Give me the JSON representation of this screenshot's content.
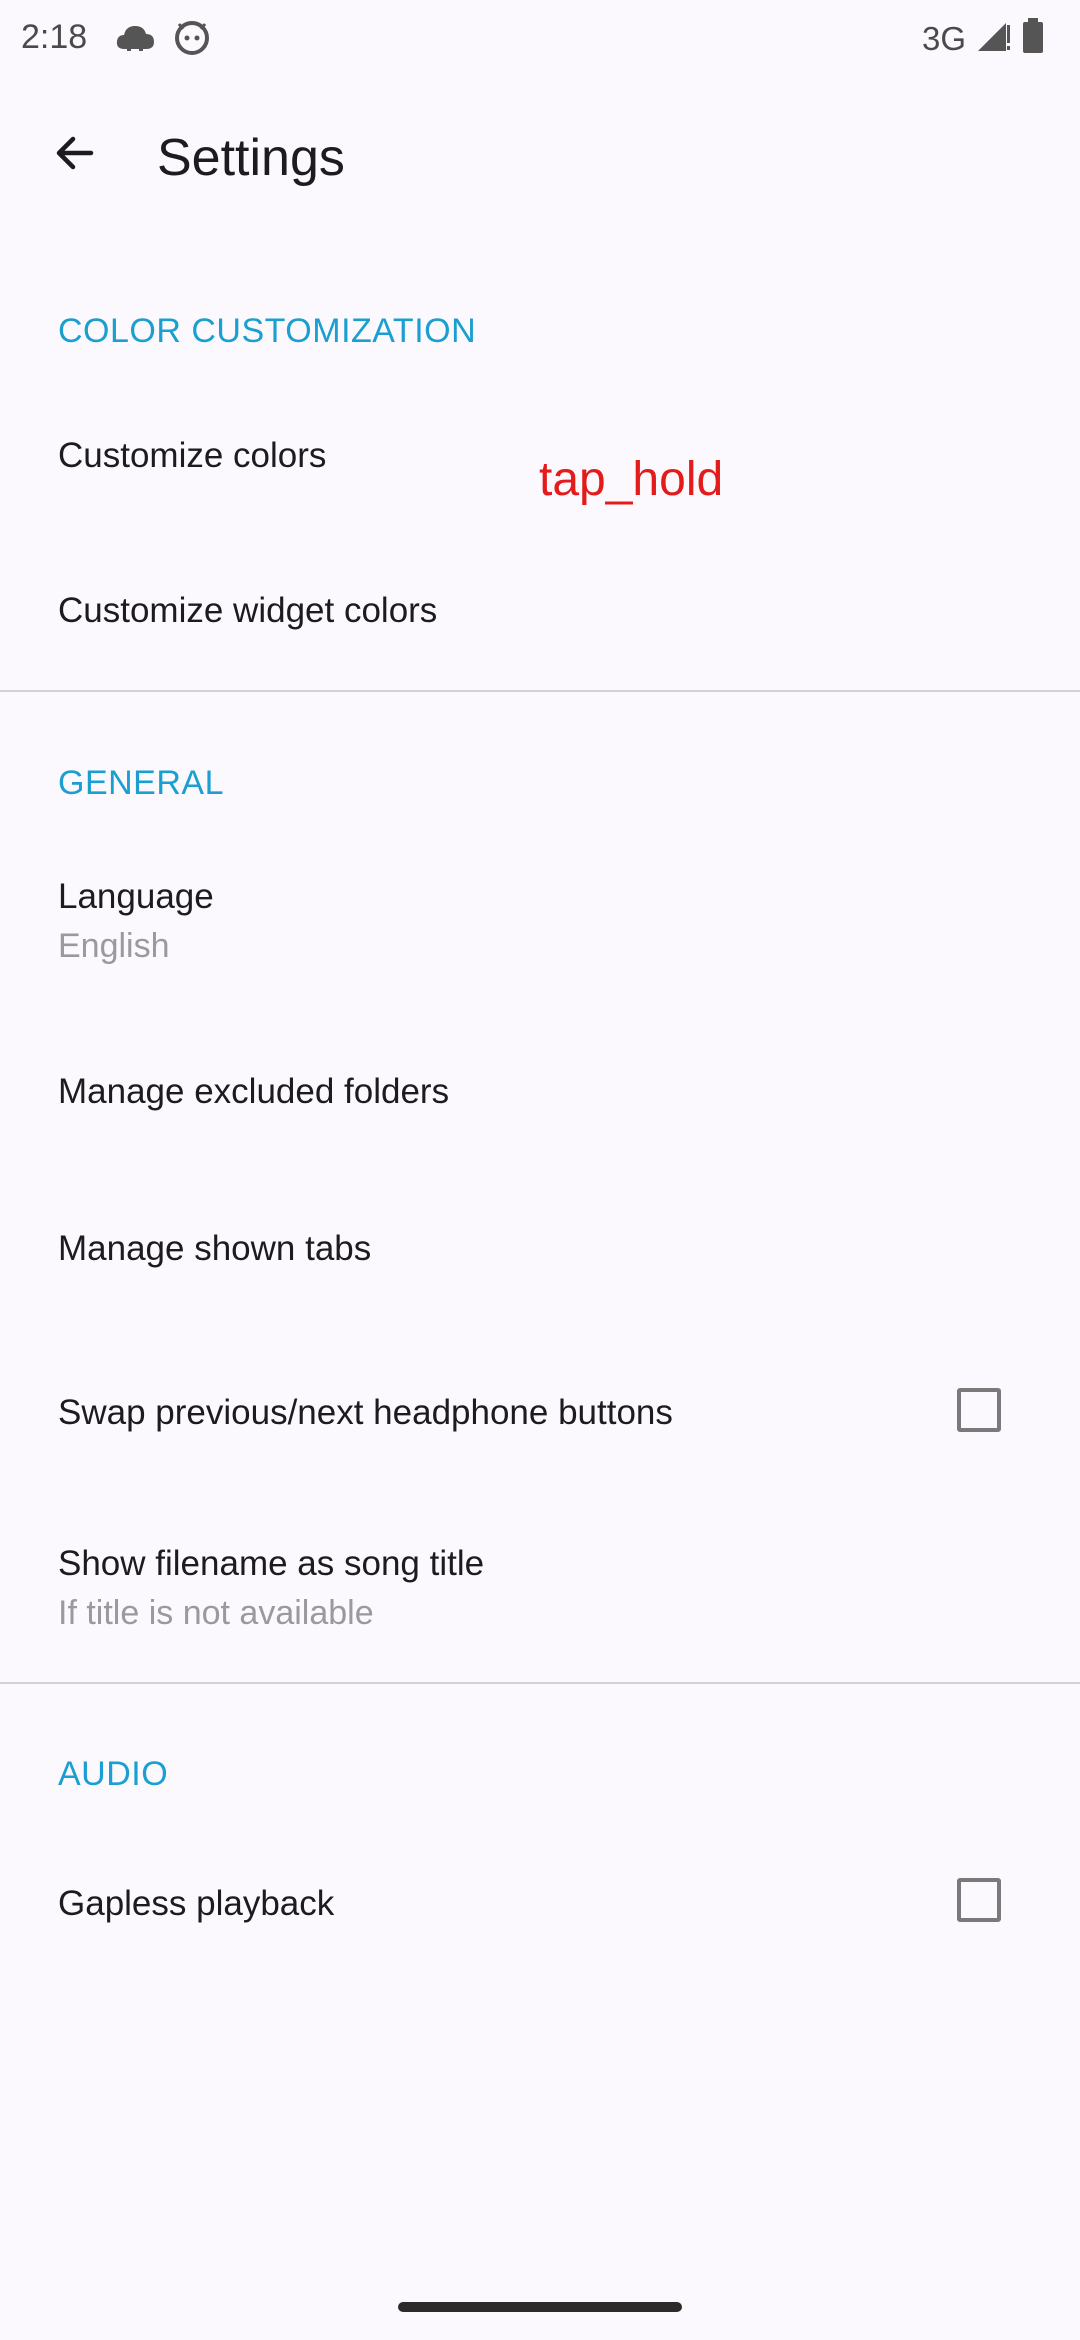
{
  "status_bar": {
    "time": "2:18",
    "network": "3G",
    "icons": [
      "cloud-alert-icon",
      "android-icon",
      "signal-icon",
      "battery-icon"
    ]
  },
  "app_bar": {
    "back_icon": "arrow-back-icon",
    "title": "Settings"
  },
  "sections": {
    "color": {
      "header": "COLOR CUSTOMIZATION",
      "items": [
        {
          "title": "Customize colors"
        },
        {
          "title": "Customize widget colors"
        }
      ]
    },
    "general": {
      "header": "GENERAL",
      "language": {
        "title": "Language",
        "value": "English"
      },
      "excluded": {
        "title": "Manage excluded folders"
      },
      "tabs": {
        "title": "Manage shown tabs"
      },
      "swap": {
        "title": "Swap previous/next headphone buttons",
        "checked": false
      },
      "filename": {
        "title": "Show filename as song title",
        "subtitle": "If title is not available"
      }
    },
    "audio": {
      "header": "AUDIO",
      "gapless": {
        "title": "Gapless playback",
        "checked": false
      }
    }
  },
  "overlay": {
    "label": "tap_hold"
  },
  "colors": {
    "accent": "#1a9fd0",
    "background": "#fbf9fe",
    "overlay_text": "#e31b1b"
  }
}
